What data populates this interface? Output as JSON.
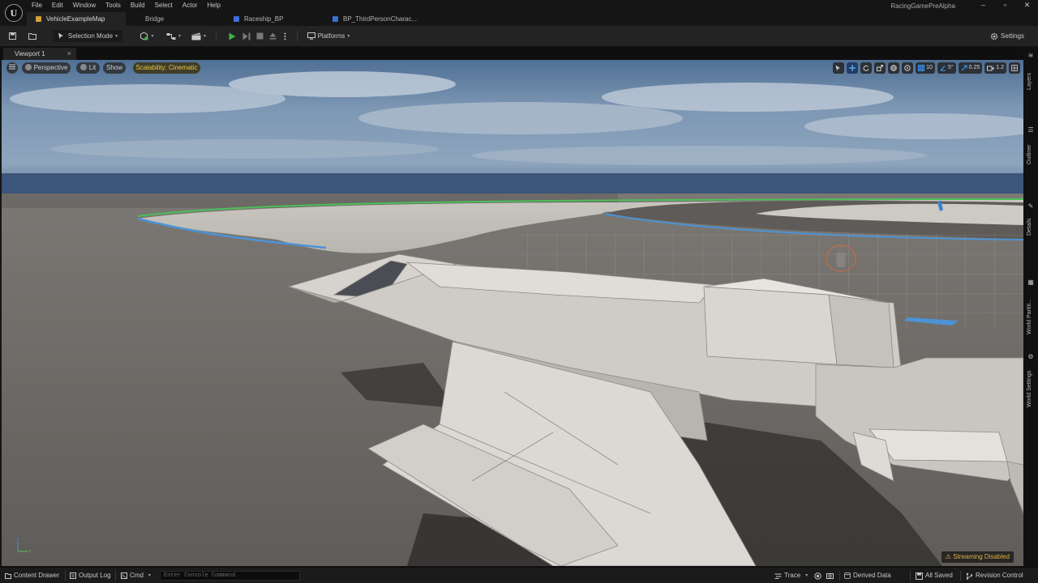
{
  "app": {
    "project_name": "RacingGamePreAlpha",
    "menus": [
      "File",
      "Edit",
      "Window",
      "Tools",
      "Build",
      "Select",
      "Actor",
      "Help"
    ],
    "tabs": [
      {
        "label": "VehicleExampleMap",
        "icon": "level-icon",
        "color": "#d4a03a"
      },
      {
        "label": "Bridge",
        "icon": "bridge-icon",
        "color": "#222222"
      },
      {
        "label": "Raceship_BP",
        "icon": "blueprint-icon",
        "color": "#3b6fd6"
      },
      {
        "label": "BP_ThirdPersonCharac...",
        "icon": "blueprint-icon",
        "color": "#3b6fd6"
      }
    ]
  },
  "toolbar": {
    "mode_label": "Selection Mode",
    "platforms_label": "Platforms",
    "settings_label": "Settings"
  },
  "viewport": {
    "tab_label": "Viewport 1",
    "perspective_label": "Perspective",
    "lit_label": "Lit",
    "show_label": "Show",
    "scalability_label": "Scalability: Cinematic",
    "grid_snap": "10",
    "rotation_snap": "5°",
    "scale_snap": "0.25",
    "camera_speed": "1.2",
    "streaming_label": "Streaming Disabled",
    "accent_color": "#3aa0ff",
    "warning_color": "#e0b040"
  },
  "side_panels": [
    "Layers",
    "Outliner",
    "Details",
    "World Partiti...",
    "World Settings"
  ],
  "statusbar": {
    "content_drawer": "Content Drawer",
    "output_log": "Output Log",
    "cmd": "Cmd",
    "console_placeholder": "Enter Console Command",
    "trace": "Trace",
    "derived_data": "Derived Data",
    "all_saved": "All Saved",
    "revision_control": "Revision Control"
  }
}
